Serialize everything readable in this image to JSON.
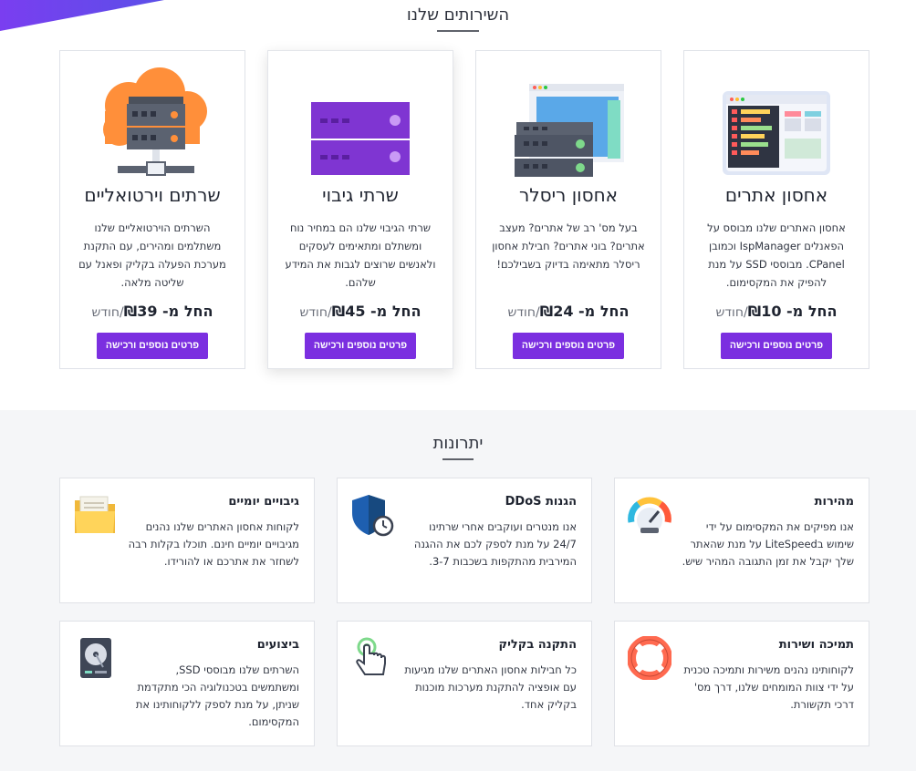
{
  "services": {
    "title": "השירותים שלנו",
    "cards": [
      {
        "title": "אחסון אתרים",
        "description": "אחסון האתרים שלנו מבוסס על הפאנלים IspManager וכמובן CPanel. מבוססי SSD על מנת להפיק את המקסימום.",
        "price_prefix": "החל מ- ₪10",
        "price_suffix": "/חודש",
        "button": "פרטים נוספים ורכישה",
        "icon": "web-hosting-dashboard-icon"
      },
      {
        "title": "אחסון ריסלר",
        "description": "בעל מס' רב של אתרים? מעצב אתרים? בוני אתרים? חבילת אחסון ריסלר מתאימה בדיוק בשבילכם!",
        "price_prefix": "החל מ- ₪24",
        "price_suffix": "/חודש",
        "button": "פרטים נוספים ורכישה",
        "icon": "reseller-server-icon"
      },
      {
        "title": "שרתי גיבוי",
        "description": "שרתי הגיבוי שלנו הם במחיר נוח ומשתלם ומתאימים לעסקים ולאנשים שרוצים לגבות את המידע שלהם.",
        "price_prefix": "החל מ- ₪45",
        "price_suffix": "/חודש",
        "button": "פרטים נוספים ורכישה",
        "icon": "backup-server-icon"
      },
      {
        "title": "שרתים וירטואליים",
        "description": "השרתים הוירטואליים שלנו משתלמים ומהירים, עם התקנת מערכת הפעלה בקליק ופאנל עם שליטה מלאה.",
        "price_prefix": "החל מ- ₪39",
        "price_suffix": "/חודש",
        "button": "פרטים נוספים ורכישה",
        "icon": "cloud-server-icon"
      }
    ]
  },
  "advantages": {
    "title": "יתרונות",
    "items": [
      {
        "title": "מהירות",
        "description": "אנו מפיקים את המקסימום על ידי שימוש בLiteSpeed על מנת שהאתר שלך יקבל את זמן התגובה המהיר שיש.",
        "icon": "speedometer-icon"
      },
      {
        "title": "הגנות DDoS",
        "description": "אנו מנטרים ועוקבים אחרי שרתינו 24/7 על מנת לספק לכם את ההגנה המירבית מהתקפות בשכבות 3-7.",
        "icon": "shield-clock-icon"
      },
      {
        "title": "גיבויים יומיים",
        "description": "לקוחות אחסון האתרים שלנו נהנים מגיבויים יומיים חינם. תוכלו בקלות רבה לשחזר את אתרכם או להורידו.",
        "icon": "folder-icon"
      },
      {
        "title": "תמיכה ושירות",
        "description": "לקוחותינו נהנים משירות ותמיכה טכנית על ידי צוות המומחים שלנו, דרך מס' דרכי תקשורת.",
        "icon": "lifebuoy-icon"
      },
      {
        "title": "התקנה בקליק",
        "description": "כל חבילות אחסון האתרים שלנו מגיעות עם אופציה להתקנת מערכות מוכנות בקליק אחד.",
        "icon": "click-hand-icon"
      },
      {
        "title": "ביצועים",
        "description": "השרתים שלנו מבוססי SSD, ומשתמשים בטכנולוגיה הכי מתקדמת שניתן, על מנת לספק ללקוחותינו את המקסימום.",
        "icon": "hard-drive-icon"
      }
    ]
  },
  "colors": {
    "accent": "#7b2fe0",
    "section_bg": "#f5f6f8",
    "orange": "#ff8f3a"
  }
}
